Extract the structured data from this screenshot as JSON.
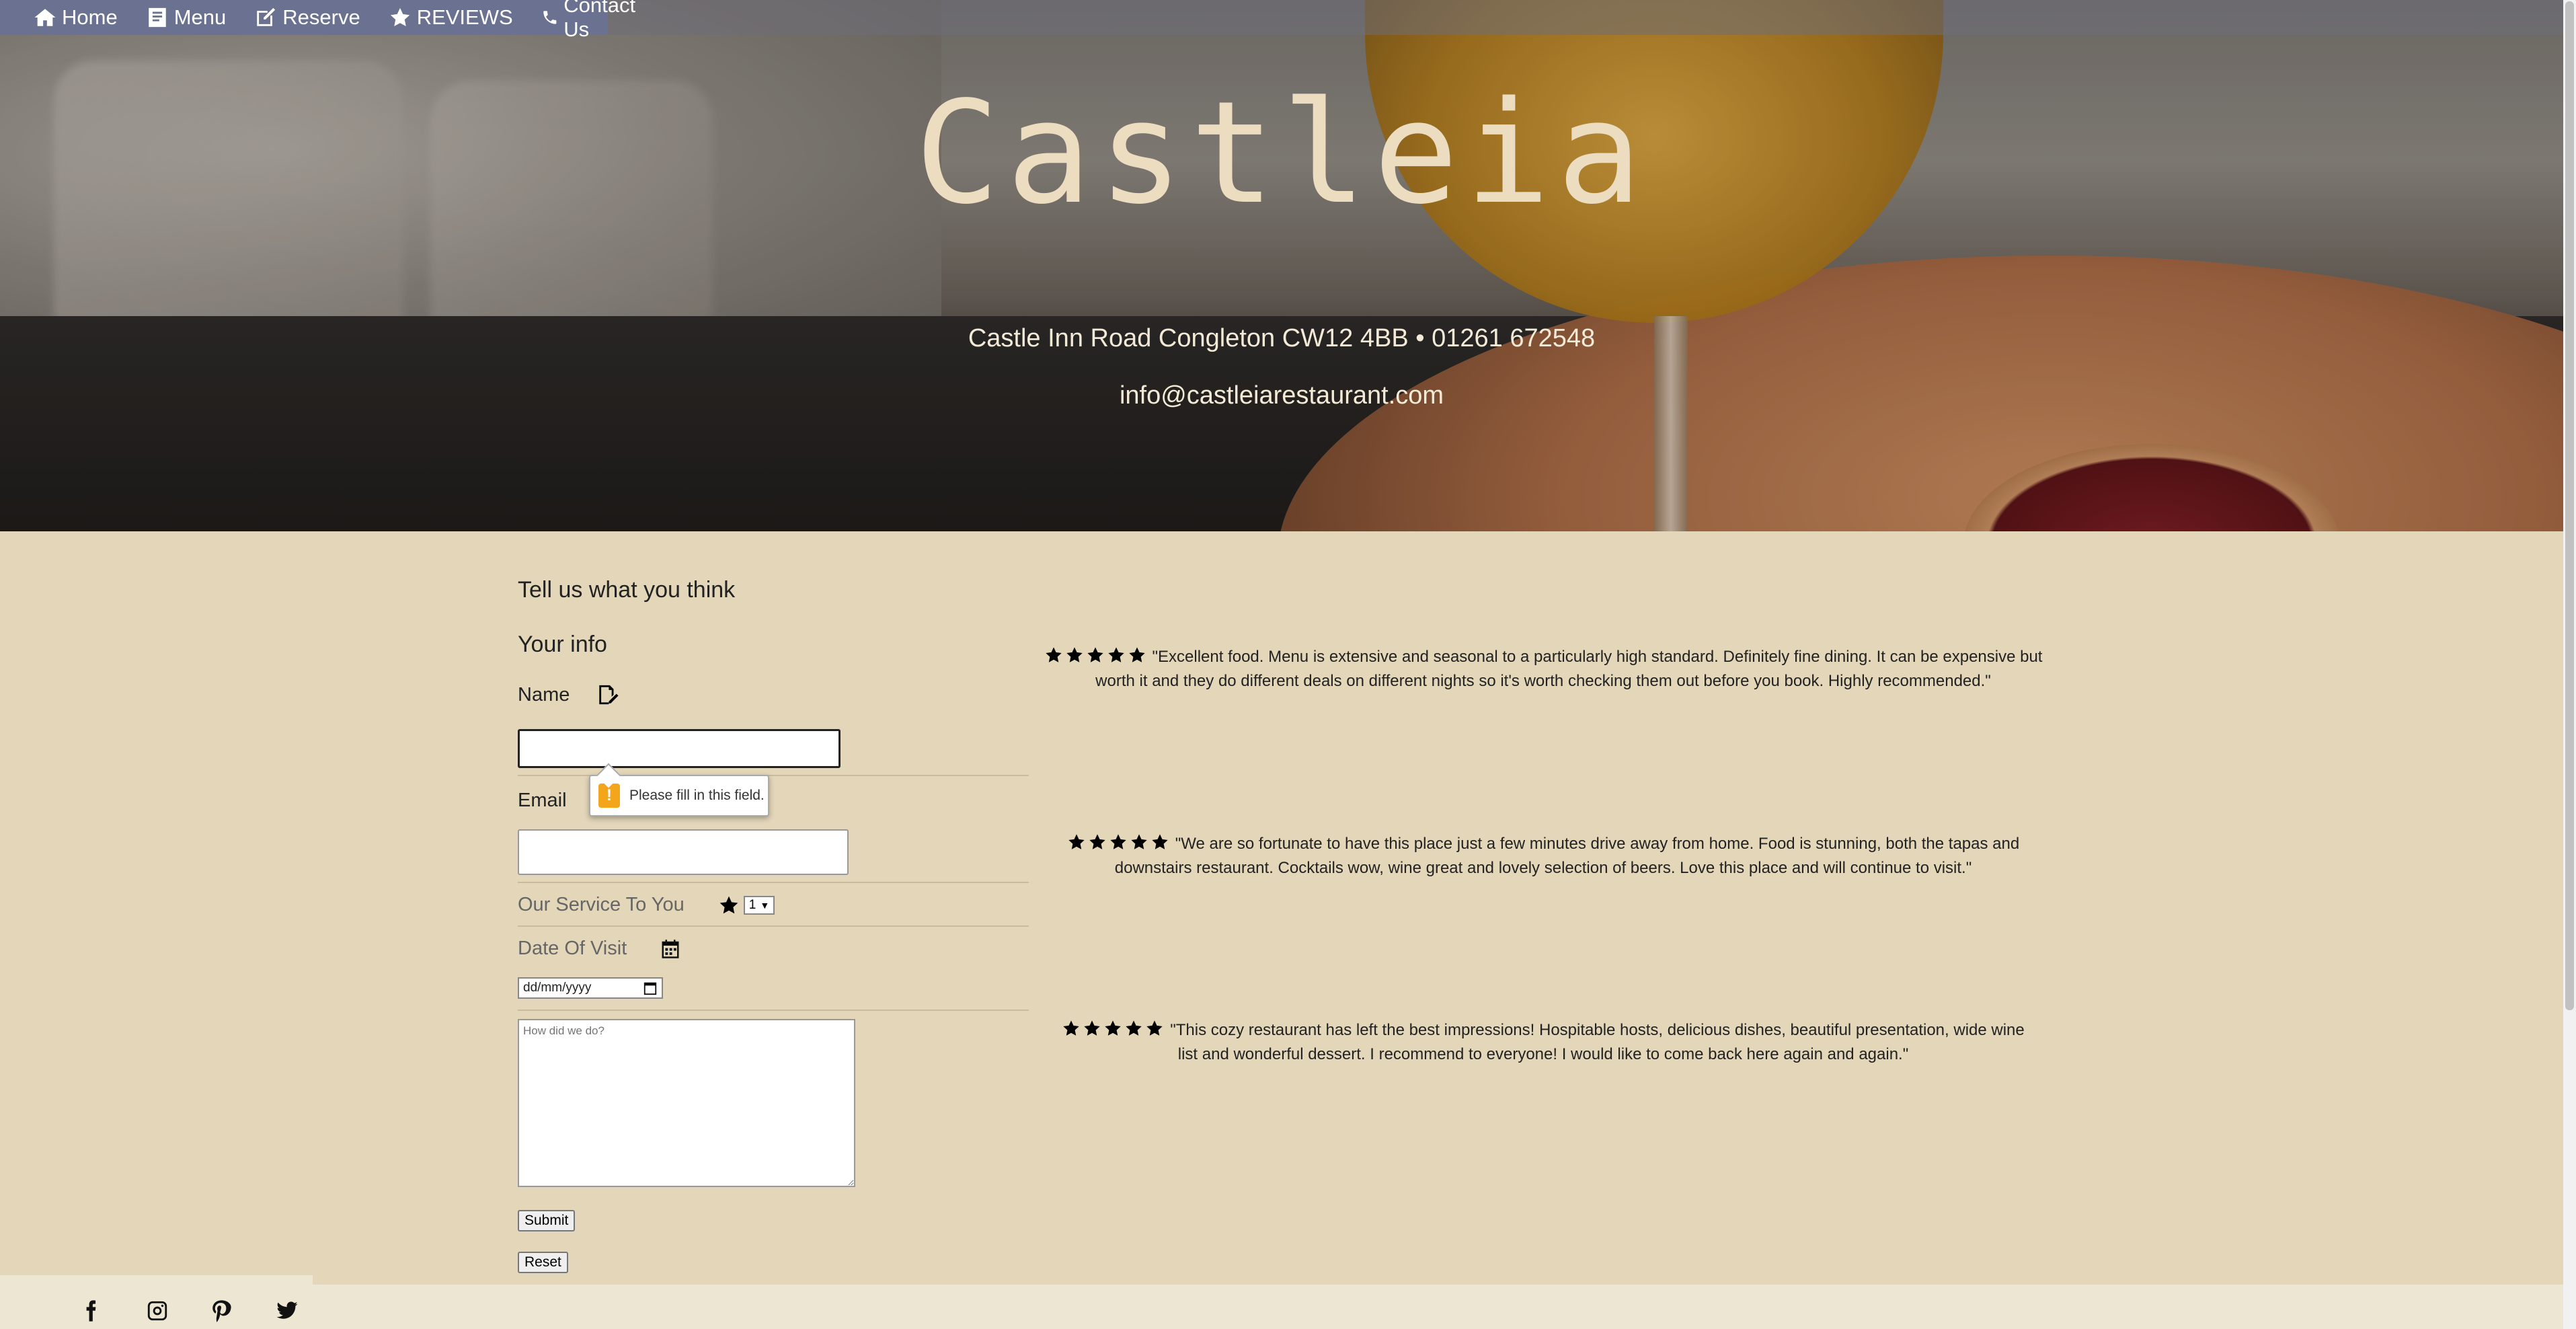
{
  "nav": {
    "items": [
      {
        "label": "Home",
        "icon": "home-icon"
      },
      {
        "label": "Menu",
        "icon": "menu-book-icon"
      },
      {
        "label": "Reserve",
        "icon": "edit-icon"
      },
      {
        "label": "REVIEWS",
        "icon": "star-icon"
      },
      {
        "label": "Contact Us",
        "icon": "phone-icon"
      }
    ]
  },
  "hero": {
    "brand": "Castleia",
    "address": "Castle Inn Road Congleton CW12 4BB • 01261 672548",
    "email": "info@castleiarestaurant.com"
  },
  "form": {
    "title": "Tell us what you think",
    "section": "Your info",
    "name_label": "Name",
    "name_value": "",
    "email_label": "Email",
    "email_value": "",
    "service_label": "Our Service To You",
    "service_value": "1",
    "date_label": "Date Of Visit",
    "date_placeholder": "dd/mm/yyyy",
    "comment_placeholder": "How did we do?",
    "submit_label": "Submit",
    "reset_label": "Reset",
    "validation_message": "Please fill in this field."
  },
  "reviews": [
    {
      "rating": 5,
      "text": "\"Excellent food. Menu is extensive and seasonal to a particularly high standard. Definitely fine dining. It can be expensive but worth it and they do different deals on different nights so it's worth checking them out before you book. Highly recommended.\""
    },
    {
      "rating": 5,
      "text": "\"We are so fortunate to have this place just a few minutes drive away from home. Food is stunning, both the tapas and downstairs restaurant. Cocktails wow, wine great and lovely selection of beers. Love this place and will continue to visit.\""
    },
    {
      "rating": 5,
      "text": "\"This cozy restaurant has left the best impressions! Hospitable hosts, delicious dishes, beautiful presentation, wide wine list and wonderful dessert. I recommend to everyone! I would like to come back here again and again.\""
    }
  ],
  "footer": {
    "social": [
      "facebook-icon",
      "instagram-icon",
      "pinterest-icon",
      "twitter-icon"
    ]
  },
  "colors": {
    "background": "#e3d6b9",
    "brand_text": "#ecdcc0",
    "nav_bg": "#6b7190",
    "warning": "#f3a51b"
  }
}
